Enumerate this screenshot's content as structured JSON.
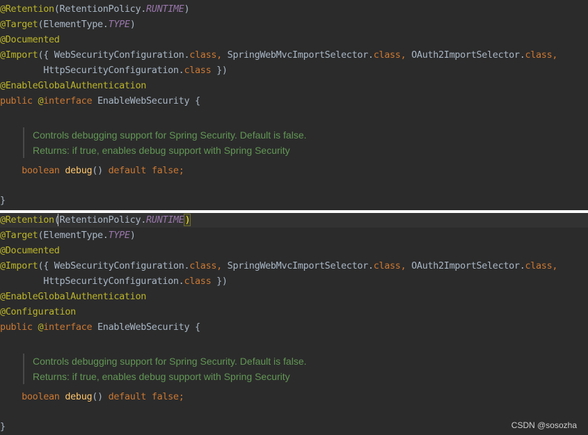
{
  "top": {
    "retention": {
      "ann": "@Retention",
      "open": "(RetentionPolicy.",
      "value": "RUNTIME",
      "close": ")"
    },
    "target": {
      "ann": "@Target",
      "open": "(ElementType.",
      "value": "TYPE",
      "close": ")"
    },
    "documented": "@Documented",
    "import": {
      "ann": "@Import",
      "open": "({ WebSecurityConfiguration.",
      "class1": "class,",
      "mid1": " SpringWebMvcImportSelector.",
      "class2": "class,",
      "mid2": " OAuth2ImportSelector.",
      "class3": "class,"
    },
    "import_cont": {
      "indent": "        HttpSecurityConfiguration.",
      "cls": "class",
      "close": " })"
    },
    "enable_global": "@EnableGlobalAuthentication",
    "decl": {
      "public": "public ",
      "at": "@",
      "iface": "interface",
      "name": " EnableWebSecurity {"
    },
    "doc": [
      "Controls debugging support for Spring Security. Default is false.",
      "Returns: if true, enables debug support with Spring Security"
    ],
    "method": {
      "indent": "    ",
      "type": "boolean",
      "name": " debug",
      "parens": "() ",
      "default": "default",
      "value": " false;"
    },
    "closing": "}"
  },
  "bottom": {
    "retention": {
      "ann": "@Retention",
      "open": "(RetentionPolicy.",
      "value": "RUNTIME",
      "close": ")"
    },
    "target": {
      "ann": "@Target",
      "open": "(ElementType.",
      "value": "TYPE",
      "close": ")"
    },
    "documented": "@Documented",
    "import": {
      "ann": "@Import",
      "open": "({ WebSecurityConfiguration.",
      "class1": "class,",
      "mid1": " SpringWebMvcImportSelector.",
      "class2": "class,",
      "mid2": " OAuth2ImportSelector.",
      "class3": "class,"
    },
    "import_cont": {
      "indent": "        HttpSecurityConfiguration.",
      "cls": "class",
      "close": " })"
    },
    "enable_global": "@EnableGlobalAuthentication",
    "configuration": "@Configuration",
    "decl": {
      "public": "public ",
      "at": "@",
      "iface": "interface",
      "name": " EnableWebSecurity {"
    },
    "doc": [
      "Controls debugging support for Spring Security. Default is false.",
      "Returns: if true, enables debug support with Spring Security"
    ],
    "method": {
      "indent": "    ",
      "type": "boolean",
      "name": " debug",
      "parens": "() ",
      "default": "default",
      "value": " false;"
    },
    "closing": "}"
  },
  "watermark": "CSDN @sosozha",
  "colors": {
    "background": "#2b2b2b",
    "annotation": "#bbb529",
    "keyword": "#cc7832",
    "constant": "#9876aa",
    "method": "#ffc66d",
    "plain": "#a9b7c6",
    "doc": "#629755"
  }
}
